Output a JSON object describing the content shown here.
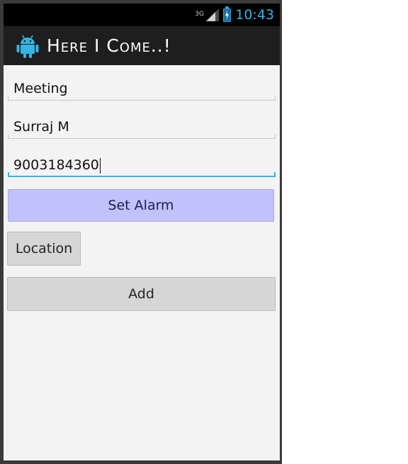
{
  "status_bar": {
    "network": "3G",
    "time": "10:43"
  },
  "action_bar": {
    "title": "Here I Come..!",
    "icon": "android-icon"
  },
  "form": {
    "field1_value": "Meeting",
    "field2_value": "Surraj M",
    "field3_value": "9003184360"
  },
  "buttons": {
    "set_alarm": "Set Alarm",
    "location": "Location",
    "add": "Add"
  },
  "colors": {
    "accent": "#33b5e5",
    "alarm_button": "#c1c1fb",
    "action_bar": "#1e1e1e"
  }
}
